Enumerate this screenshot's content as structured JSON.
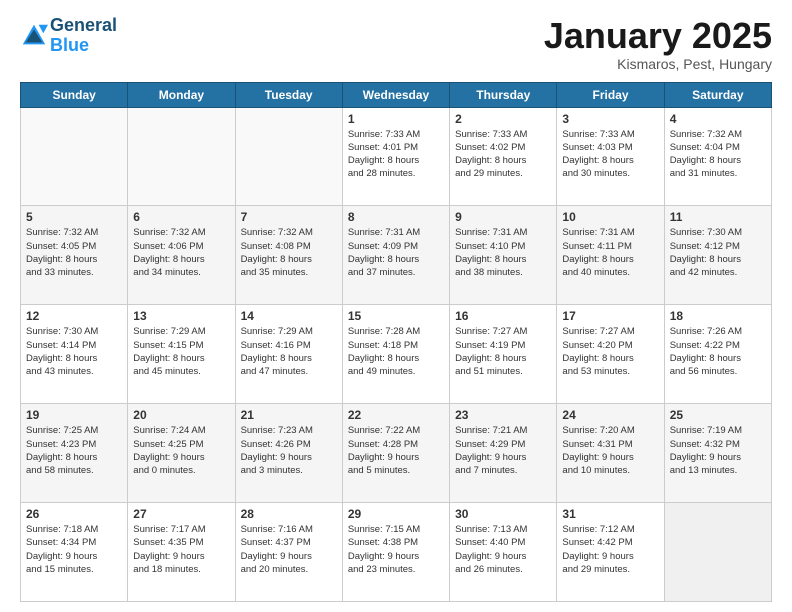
{
  "header": {
    "logo_line1": "General",
    "logo_line2": "Blue",
    "month": "January 2025",
    "location": "Kismaros, Pest, Hungary"
  },
  "days_of_week": [
    "Sunday",
    "Monday",
    "Tuesday",
    "Wednesday",
    "Thursday",
    "Friday",
    "Saturday"
  ],
  "weeks": [
    [
      {
        "day": "",
        "info": ""
      },
      {
        "day": "",
        "info": ""
      },
      {
        "day": "",
        "info": ""
      },
      {
        "day": "1",
        "info": "Sunrise: 7:33 AM\nSunset: 4:01 PM\nDaylight: 8 hours\nand 28 minutes."
      },
      {
        "day": "2",
        "info": "Sunrise: 7:33 AM\nSunset: 4:02 PM\nDaylight: 8 hours\nand 29 minutes."
      },
      {
        "day": "3",
        "info": "Sunrise: 7:33 AM\nSunset: 4:03 PM\nDaylight: 8 hours\nand 30 minutes."
      },
      {
        "day": "4",
        "info": "Sunrise: 7:32 AM\nSunset: 4:04 PM\nDaylight: 8 hours\nand 31 minutes."
      }
    ],
    [
      {
        "day": "5",
        "info": "Sunrise: 7:32 AM\nSunset: 4:05 PM\nDaylight: 8 hours\nand 33 minutes."
      },
      {
        "day": "6",
        "info": "Sunrise: 7:32 AM\nSunset: 4:06 PM\nDaylight: 8 hours\nand 34 minutes."
      },
      {
        "day": "7",
        "info": "Sunrise: 7:32 AM\nSunset: 4:08 PM\nDaylight: 8 hours\nand 35 minutes."
      },
      {
        "day": "8",
        "info": "Sunrise: 7:31 AM\nSunset: 4:09 PM\nDaylight: 8 hours\nand 37 minutes."
      },
      {
        "day": "9",
        "info": "Sunrise: 7:31 AM\nSunset: 4:10 PM\nDaylight: 8 hours\nand 38 minutes."
      },
      {
        "day": "10",
        "info": "Sunrise: 7:31 AM\nSunset: 4:11 PM\nDaylight: 8 hours\nand 40 minutes."
      },
      {
        "day": "11",
        "info": "Sunrise: 7:30 AM\nSunset: 4:12 PM\nDaylight: 8 hours\nand 42 minutes."
      }
    ],
    [
      {
        "day": "12",
        "info": "Sunrise: 7:30 AM\nSunset: 4:14 PM\nDaylight: 8 hours\nand 43 minutes."
      },
      {
        "day": "13",
        "info": "Sunrise: 7:29 AM\nSunset: 4:15 PM\nDaylight: 8 hours\nand 45 minutes."
      },
      {
        "day": "14",
        "info": "Sunrise: 7:29 AM\nSunset: 4:16 PM\nDaylight: 8 hours\nand 47 minutes."
      },
      {
        "day": "15",
        "info": "Sunrise: 7:28 AM\nSunset: 4:18 PM\nDaylight: 8 hours\nand 49 minutes."
      },
      {
        "day": "16",
        "info": "Sunrise: 7:27 AM\nSunset: 4:19 PM\nDaylight: 8 hours\nand 51 minutes."
      },
      {
        "day": "17",
        "info": "Sunrise: 7:27 AM\nSunset: 4:20 PM\nDaylight: 8 hours\nand 53 minutes."
      },
      {
        "day": "18",
        "info": "Sunrise: 7:26 AM\nSunset: 4:22 PM\nDaylight: 8 hours\nand 56 minutes."
      }
    ],
    [
      {
        "day": "19",
        "info": "Sunrise: 7:25 AM\nSunset: 4:23 PM\nDaylight: 8 hours\nand 58 minutes."
      },
      {
        "day": "20",
        "info": "Sunrise: 7:24 AM\nSunset: 4:25 PM\nDaylight: 9 hours\nand 0 minutes."
      },
      {
        "day": "21",
        "info": "Sunrise: 7:23 AM\nSunset: 4:26 PM\nDaylight: 9 hours\nand 3 minutes."
      },
      {
        "day": "22",
        "info": "Sunrise: 7:22 AM\nSunset: 4:28 PM\nDaylight: 9 hours\nand 5 minutes."
      },
      {
        "day": "23",
        "info": "Sunrise: 7:21 AM\nSunset: 4:29 PM\nDaylight: 9 hours\nand 7 minutes."
      },
      {
        "day": "24",
        "info": "Sunrise: 7:20 AM\nSunset: 4:31 PM\nDaylight: 9 hours\nand 10 minutes."
      },
      {
        "day": "25",
        "info": "Sunrise: 7:19 AM\nSunset: 4:32 PM\nDaylight: 9 hours\nand 13 minutes."
      }
    ],
    [
      {
        "day": "26",
        "info": "Sunrise: 7:18 AM\nSunset: 4:34 PM\nDaylight: 9 hours\nand 15 minutes."
      },
      {
        "day": "27",
        "info": "Sunrise: 7:17 AM\nSunset: 4:35 PM\nDaylight: 9 hours\nand 18 minutes."
      },
      {
        "day": "28",
        "info": "Sunrise: 7:16 AM\nSunset: 4:37 PM\nDaylight: 9 hours\nand 20 minutes."
      },
      {
        "day": "29",
        "info": "Sunrise: 7:15 AM\nSunset: 4:38 PM\nDaylight: 9 hours\nand 23 minutes."
      },
      {
        "day": "30",
        "info": "Sunrise: 7:13 AM\nSunset: 4:40 PM\nDaylight: 9 hours\nand 26 minutes."
      },
      {
        "day": "31",
        "info": "Sunrise: 7:12 AM\nSunset: 4:42 PM\nDaylight: 9 hours\nand 29 minutes."
      },
      {
        "day": "",
        "info": ""
      }
    ]
  ]
}
